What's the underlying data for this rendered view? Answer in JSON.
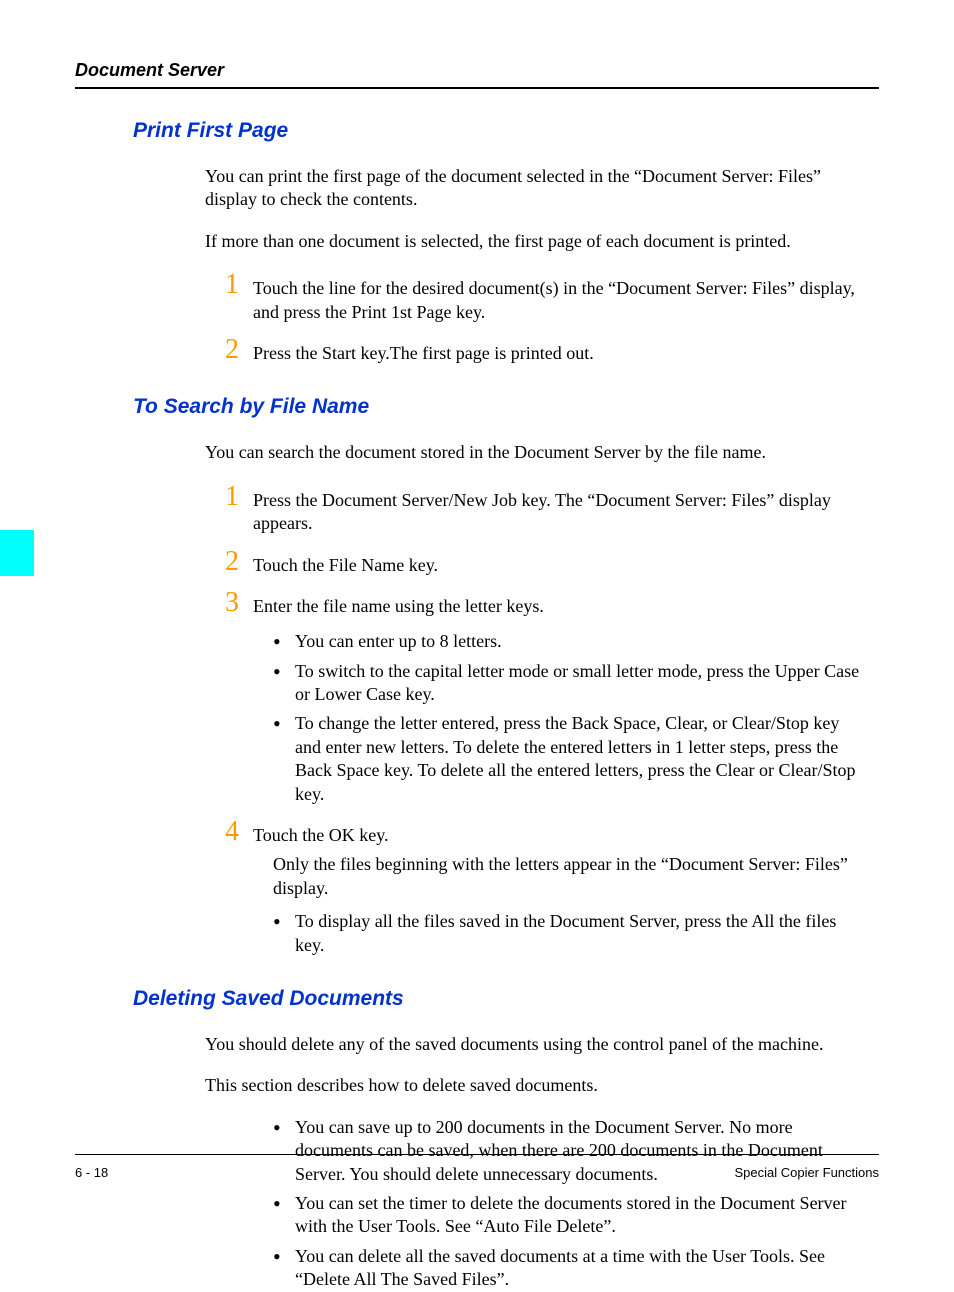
{
  "header": {
    "title": "Document Server"
  },
  "sections": {
    "print_first_page": {
      "heading": "Print First Page",
      "intro1": "You can print the first page of the document selected in the “Document Server: Files” display to check the contents.",
      "intro2": "If more than one document is selected, the first page of each document is printed.",
      "steps": [
        "Touch the line for the desired document(s) in the “Document Server: Files” display, and press the Print 1st Page key.",
        "Press the Start key.The first page is printed out."
      ]
    },
    "search_by_file_name": {
      "heading": "To Search by File Name",
      "intro1": "You can search the document stored in the Document Server by the file name.",
      "steps": [
        {
          "text": "Press the Document Server/New Job key. The “Document Server: Files” display appears."
        },
        {
          "text": "Touch the File Name key."
        },
        {
          "text": "Enter the file name using the letter keys.",
          "bullets": [
            "You can enter up to 8 letters.",
            "To switch to the capital letter mode or small letter mode, press the Upper Case or Lower Case key.",
            "To change the letter entered, press the Back Space, Clear, or Clear/Stop key and enter new letters. To delete the entered letters in 1 letter steps, press the Back Space key. To delete all the entered letters, press the Clear or Clear/Stop key."
          ]
        },
        {
          "text": "Touch the OK key.",
          "extra": "Only the files beginning with the letters appear in the “Document Server: Files” display.",
          "bullets": [
            "To display all the files saved in the Document Server, press the All the files key."
          ]
        }
      ]
    },
    "deleting_saved_documents": {
      "heading": "Deleting Saved Documents",
      "intro1": "You should delete any of the saved documents using the control panel of the machine.",
      "intro2": "This section describes how to delete saved documents.",
      "bullets": [
        "You can save up to 200 documents in the Document Server. No more documents can be saved, when there are 200 documents in the Document Server. You should delete unnecessary documents.",
        "You can set the timer to delete the documents stored in the Document Server with the User Tools. See “Auto File Delete”.",
        "You can delete all the saved documents at a time with the User Tools. See “Delete All The Saved Files”."
      ]
    }
  },
  "footer": {
    "left": "6 - 18",
    "right": "Special Copier Functions"
  }
}
